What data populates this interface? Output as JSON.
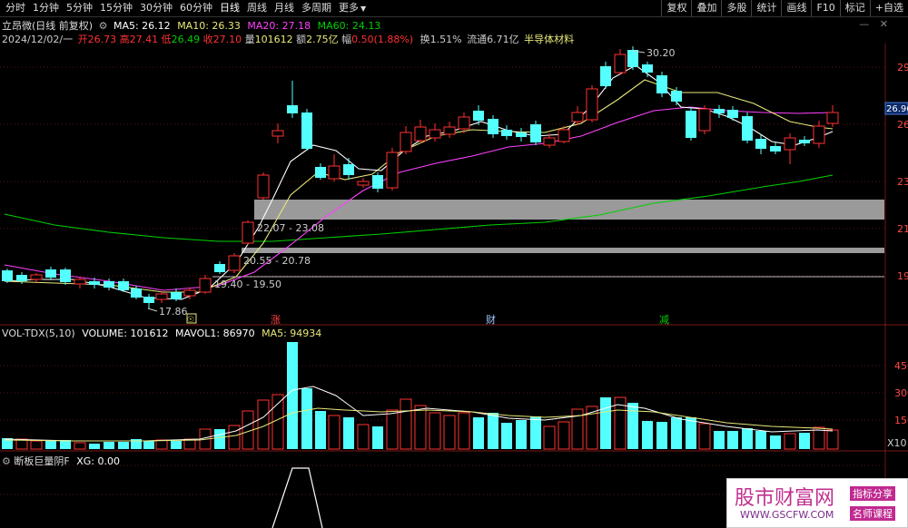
{
  "toolbar": {
    "tabs": [
      "分时",
      "1分钟",
      "5分钟",
      "15分钟",
      "30分钟",
      "60分钟",
      "日线",
      "周线",
      "月线",
      "多周期",
      "更多"
    ],
    "active_tab": "日线",
    "right": [
      "复权",
      "叠加",
      "多股",
      "统计",
      "画线",
      "F10",
      "标记",
      "+自选"
    ]
  },
  "header": {
    "title": "立昂微(日线 前复权)",
    "ma5": "MA5: 26.12",
    "ma10": "MA10: 26.33",
    "ma20": "MA20: 27.18",
    "ma60": "MA60: 24.13",
    "date": "2024/12/02/一",
    "open_label": "开",
    "open": "26.73",
    "high_label": "高",
    "high": "27.41",
    "low_label": "低",
    "low": "26.49",
    "close_label": "收",
    "close": "27.10",
    "vol_label": "量",
    "vol": "101612",
    "amount_label": "额",
    "amount": "2.75亿",
    "range_label": "幅",
    "range": "0.50(1.88%)",
    "turnover": "换1.51%",
    "float": "流通6.71亿",
    "sector": "半导体材料"
  },
  "price_axis": {
    "ticks": [
      "29",
      "26",
      "23",
      "21",
      "19"
    ],
    "current": "26.96"
  },
  "annotations": {
    "high_mark": "30.20",
    "low_mark": "17.86",
    "zone1": "22.07 - 23.08",
    "zone2": "20.55 - 20.78",
    "zone3": "19.40 - 19.50"
  },
  "events": [
    {
      "label": "☉"
    },
    {
      "label": "涨"
    },
    {
      "label": "财"
    },
    {
      "label": "减"
    }
  ],
  "volume_panel": {
    "title": "VOL-TDX(5,10)",
    "volume": "VOLUME: 101612",
    "mavol1": "MAVOL1: 86970",
    "ma5": "MA5: 94934",
    "ticks": [
      "450",
      "300",
      "150"
    ],
    "unit": "X10"
  },
  "indicator_panel": {
    "title": "断板巨量阴F",
    "value": "XG: 0.00"
  },
  "watermark": {
    "title": "股市财富网",
    "url": "WWW.GSCFW.COM",
    "tag1": "指标分享",
    "tag2": "名师课程"
  },
  "colors": {
    "up": "#ff3232",
    "down": "#54ffff",
    "ma5": "#ffffff",
    "ma10": "#e8e87a",
    "ma20": "#ff40ff",
    "ma60": "#00d000",
    "zone": "#9a9a9a"
  }
}
